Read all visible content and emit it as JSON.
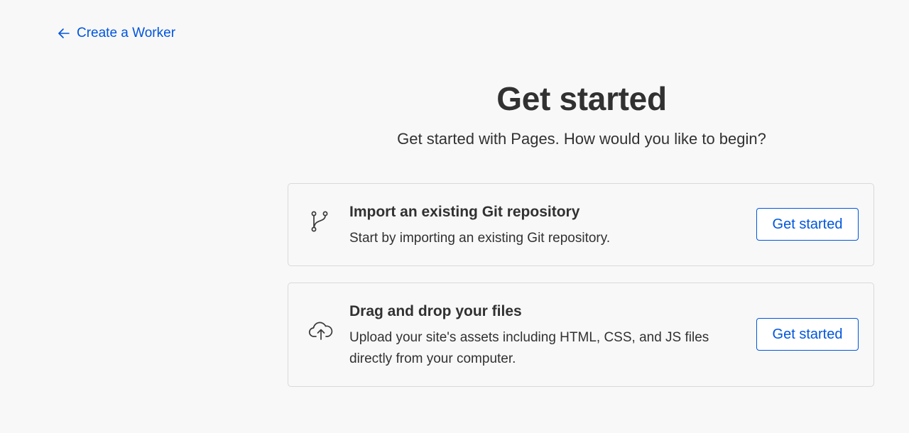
{
  "back_link": {
    "label": "Create a Worker",
    "icon": "arrow-left-icon"
  },
  "page": {
    "title": "Get started",
    "subtitle": "Get started with Pages. How would you like to begin?"
  },
  "options": [
    {
      "icon": "git-branch-icon",
      "title": "Import an existing Git repository",
      "description": "Start by importing an existing Git repository.",
      "button_label": "Get started"
    },
    {
      "icon": "cloud-upload-icon",
      "title": "Drag and drop your files",
      "description": "Upload your site's assets including HTML, CSS, and JS files directly from your computer.",
      "button_label": "Get started"
    }
  ],
  "colors": {
    "accent": "#0055dc",
    "text": "#313131",
    "background": "#f8f8f8",
    "border": "#d9d9d9"
  }
}
